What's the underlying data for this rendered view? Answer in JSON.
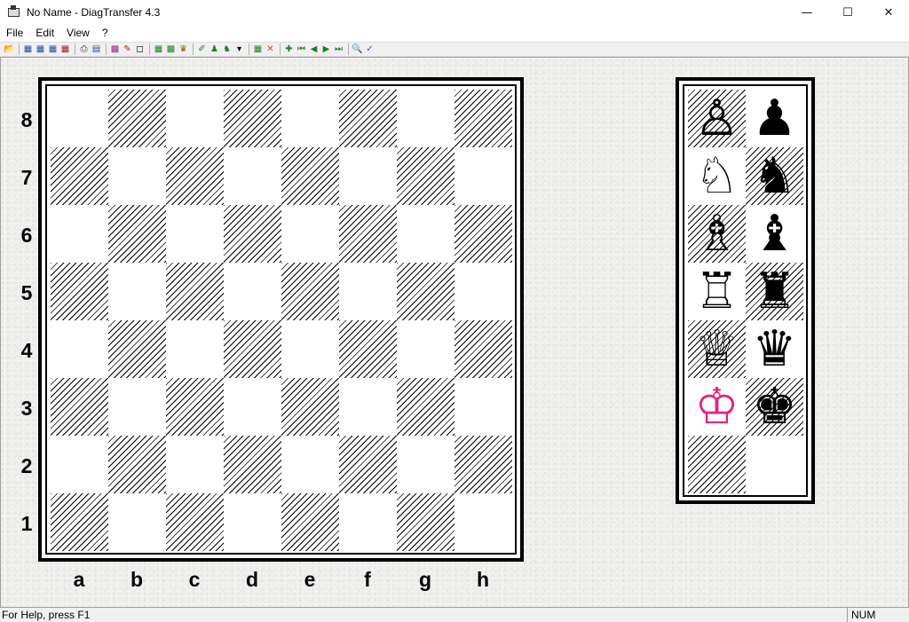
{
  "window": {
    "title": "No Name - DiagTransfer 4.3",
    "minimize": "—",
    "maximize": "☐",
    "close": "✕"
  },
  "menu": [
    "File",
    "Edit",
    "View",
    "?"
  ],
  "toolbar": {
    "groups": [
      [
        {
          "name": "open-icon",
          "glyph": "📂",
          "color": "#c8a000"
        }
      ],
      [
        {
          "name": "diagram-type1-icon",
          "glyph": "▦",
          "color": "#2050a0"
        },
        {
          "name": "diagram-type2-icon",
          "glyph": "▦",
          "color": "#2050a0"
        },
        {
          "name": "diagram-type3-icon",
          "glyph": "▦",
          "color": "#2050a0"
        },
        {
          "name": "diagram-type4-icon",
          "glyph": "▦",
          "color": "#a02020"
        }
      ],
      [
        {
          "name": "print-icon",
          "glyph": "⎙",
          "color": "#404040"
        },
        {
          "name": "print-preview-icon",
          "glyph": "▤",
          "color": "#2050a0"
        }
      ],
      [
        {
          "name": "board-setup-icon",
          "glyph": "▩",
          "color": "#a02080"
        },
        {
          "name": "edit-board-icon",
          "glyph": "✎",
          "color": "#a02020"
        },
        {
          "name": "frame-icon",
          "glyph": "◻",
          "color": "#000000"
        }
      ],
      [
        {
          "name": "grid-icon",
          "glyph": "▦",
          "color": "#208020"
        },
        {
          "name": "checker-icon",
          "glyph": "▩",
          "color": "#208020"
        },
        {
          "name": "crown-icon",
          "glyph": "♛",
          "color": "#806000"
        }
      ],
      [
        {
          "name": "pen-icon",
          "glyph": "✐",
          "color": "#208020"
        },
        {
          "name": "person-icon",
          "glyph": "♟",
          "color": "#208020"
        },
        {
          "name": "pieces-dropdown-icon",
          "glyph": "♞",
          "color": "#208020"
        },
        {
          "name": "dropdown-arrow-icon",
          "glyph": "▾",
          "color": "#000000"
        }
      ],
      [
        {
          "name": "new-board-icon",
          "glyph": "▦",
          "color": "#208020"
        },
        {
          "name": "clear-icon",
          "glyph": "✕",
          "color": "#e04020"
        }
      ],
      [
        {
          "name": "add-icon",
          "glyph": "✚",
          "color": "#208020"
        },
        {
          "name": "first-icon",
          "glyph": "⏮",
          "color": "#208020"
        },
        {
          "name": "prev-icon",
          "glyph": "◀",
          "color": "#208020"
        },
        {
          "name": "next-icon",
          "glyph": "▶",
          "color": "#208020"
        },
        {
          "name": "last-icon",
          "glyph": "⏭",
          "color": "#208020"
        }
      ],
      [
        {
          "name": "zoom-icon",
          "glyph": "🔍",
          "color": "#404040"
        },
        {
          "name": "magic-wand-icon",
          "glyph": "✓",
          "color": "#2060c0"
        }
      ]
    ]
  },
  "board": {
    "ranks": [
      "8",
      "7",
      "6",
      "5",
      "4",
      "3",
      "2",
      "1"
    ],
    "files": [
      "a",
      "b",
      "c",
      "d",
      "e",
      "f",
      "g",
      "h"
    ]
  },
  "palette": {
    "rows": [
      [
        {
          "glyph": "♙",
          "piece": "white-pawn",
          "dark": true
        },
        {
          "glyph": "♟",
          "piece": "black-pawn",
          "dark": false
        }
      ],
      [
        {
          "glyph": "♘",
          "piece": "white-knight",
          "dark": false
        },
        {
          "glyph": "♞",
          "piece": "black-knight",
          "dark": true
        }
      ],
      [
        {
          "glyph": "♗",
          "piece": "white-bishop",
          "dark": true
        },
        {
          "glyph": "♝",
          "piece": "black-bishop",
          "dark": false
        }
      ],
      [
        {
          "glyph": "♖",
          "piece": "white-rook",
          "dark": false
        },
        {
          "glyph": "♜",
          "piece": "black-rook",
          "dark": true
        }
      ],
      [
        {
          "glyph": "♕",
          "piece": "white-queen",
          "dark": true
        },
        {
          "glyph": "♛",
          "piece": "black-queen",
          "dark": false
        }
      ],
      [
        {
          "glyph": "♔",
          "piece": "white-king",
          "dark": false,
          "selected": true
        },
        {
          "glyph": "♚",
          "piece": "black-king",
          "dark": true
        }
      ],
      [
        {
          "glyph": "",
          "piece": "empty-square",
          "dark": true
        },
        {
          "glyph": "",
          "piece": "light-square",
          "dark": false
        }
      ]
    ],
    "selected_color": "#e8207c"
  },
  "status": {
    "help": "For Help, press F1",
    "num": "NUM"
  }
}
